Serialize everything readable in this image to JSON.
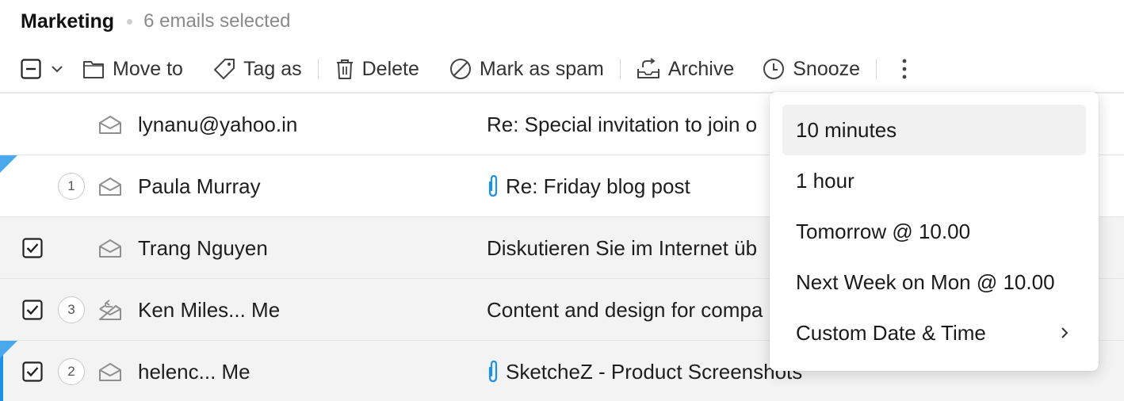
{
  "header": {
    "folder": "Marketing",
    "selected": "6 emails selected"
  },
  "toolbar": {
    "move_to": "Move to",
    "tag_as": "Tag as",
    "delete": "Delete",
    "spam": "Mark as spam",
    "archive": "Archive",
    "snooze": "Snooze"
  },
  "emails": [
    {
      "sender": "lynanu@yahoo.in",
      "subject": "Re: Special invitation to join o",
      "checked": false,
      "count": "",
      "attachment": false
    },
    {
      "sender": "Paula Murray",
      "subject": "Re: Friday blog post",
      "checked": false,
      "count": "1",
      "attachment": true
    },
    {
      "sender": "Trang Nguyen",
      "subject": "Diskutieren Sie im Internet üb",
      "checked": true,
      "count": "",
      "attachment": false
    },
    {
      "sender": "Ken Miles... Me",
      "subject": "Content and design for compa",
      "checked": true,
      "count": "3",
      "attachment": false
    },
    {
      "sender": "helenc... Me",
      "subject": "SketcheZ - Product Screenshots",
      "checked": true,
      "count": "2",
      "attachment": true
    }
  ],
  "snooze_menu": {
    "items": [
      "10 minutes",
      "1 hour",
      "Tomorrow @ 10.00",
      "Next Week on Mon @ 10.00",
      "Custom Date & Time"
    ]
  },
  "colors": {
    "accent": "#1d90e8",
    "flag": "#4aa8ec",
    "selected_row": "#f3f3f3"
  }
}
